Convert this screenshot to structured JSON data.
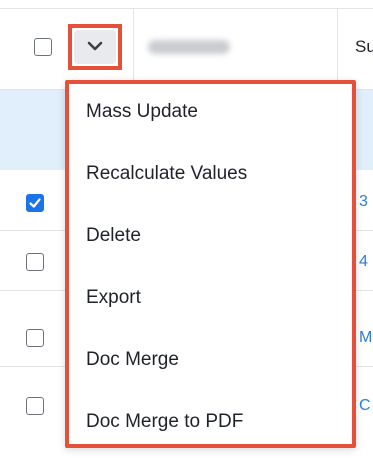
{
  "header": {
    "column_label": "Su"
  },
  "rows": [
    {
      "checked": true,
      "link_text": "3"
    },
    {
      "checked": false,
      "link_text": "4"
    },
    {
      "checked": false,
      "link_text": "M"
    },
    {
      "checked": false,
      "link_text": "C"
    }
  ],
  "menu": {
    "items": [
      {
        "label": "Mass Update"
      },
      {
        "label": "Recalculate Values"
      },
      {
        "label": "Delete"
      },
      {
        "label": "Export"
      },
      {
        "label": "Doc Merge"
      },
      {
        "label": "Doc Merge to PDF"
      }
    ]
  },
  "colors": {
    "highlight_border": "#e4503a",
    "checkbox_checked": "#1a73e8",
    "link": "#2a7fd4",
    "row_highlight": "#e1eefb"
  },
  "icons": {
    "toggle": "chevron-down-icon",
    "checked": "checkmark-icon"
  }
}
